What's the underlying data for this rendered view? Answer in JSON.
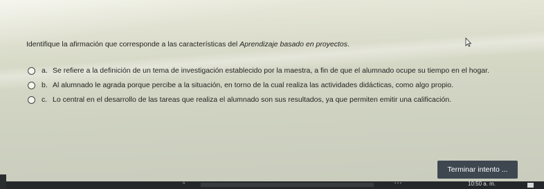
{
  "question": {
    "prefix": "Identifique la afirmación que corresponde a las características del ",
    "emphasis": "Aprendizaje basado en proyectos",
    "suffix": "."
  },
  "options": [
    {
      "letter": "a.",
      "text": "Se refiere a la definición de un tema de investigación establecido por la maestra, a fin de que el alumnado ocupe su tiempo en el hogar."
    },
    {
      "letter": "b.",
      "text": "Al alumnado le agrada porque percibe a la situación, en torno de la cual realiza las actividades didácticas, como algo propio."
    },
    {
      "letter": "c.",
      "text": "Lo central en el desarrollo de las tareas que realiza el alumnado son sus resultados, ya que permiten emitir una calificación."
    }
  ],
  "finish_button": "Terminar intento ...",
  "taskbar": {
    "clock": "10:50 a. m."
  },
  "icons": {
    "cursor": "mouse-pointer-icon",
    "caret": "chevron-up-icon",
    "notifications": "notification-icon"
  }
}
